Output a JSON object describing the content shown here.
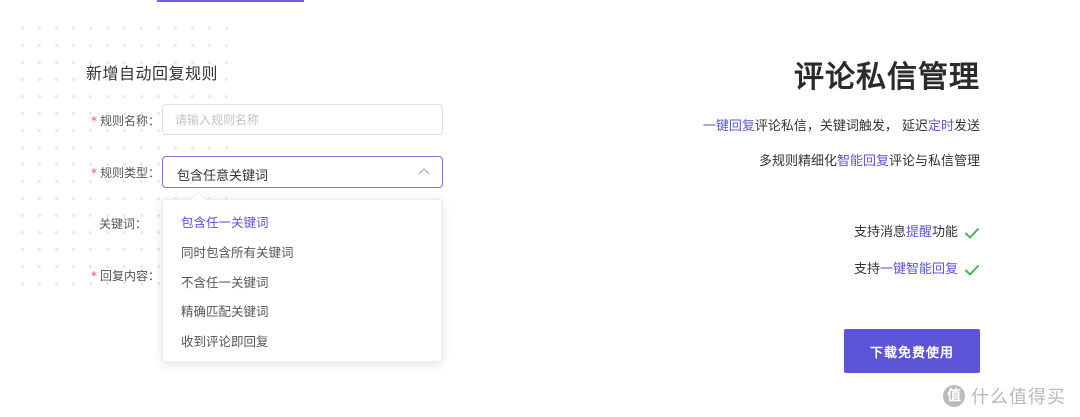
{
  "form": {
    "title": "新增自动回复规则",
    "rule_name": {
      "label": "规则名称：",
      "placeholder": "请输入规则名称"
    },
    "rule_type": {
      "label": "规则类型：",
      "value": "包含任意关键词"
    },
    "keywords_label": "关键词：",
    "reply_label": "回复内容：",
    "dropdown_options": [
      "包含任一关键词",
      "同时包含所有关键词",
      "不含任一关键词",
      "精确匹配关键词",
      "收到评论即回复"
    ]
  },
  "hero": {
    "title": "评论私信管理",
    "line1": {
      "hl1": "一键回复",
      "t1": "评论私信，关键词触发， 延迟",
      "hl2": "定时",
      "t2": "发送"
    },
    "line2": {
      "t1": "多规则精细化",
      "hl1": "智能回复",
      "t2": "评论与私信管理"
    },
    "feature1": {
      "t1": "支持消息",
      "hl1": "提醒",
      "t2": "功能"
    },
    "feature2": {
      "t1": "支持",
      "hl1": "一键智能回复"
    },
    "cta_label": "下载免费使用"
  },
  "watermark": {
    "badge": "值",
    "text": "什么值得买"
  },
  "colors": {
    "accent": "#5b54d6",
    "check": "#4caf50",
    "required": "#e4574e"
  }
}
